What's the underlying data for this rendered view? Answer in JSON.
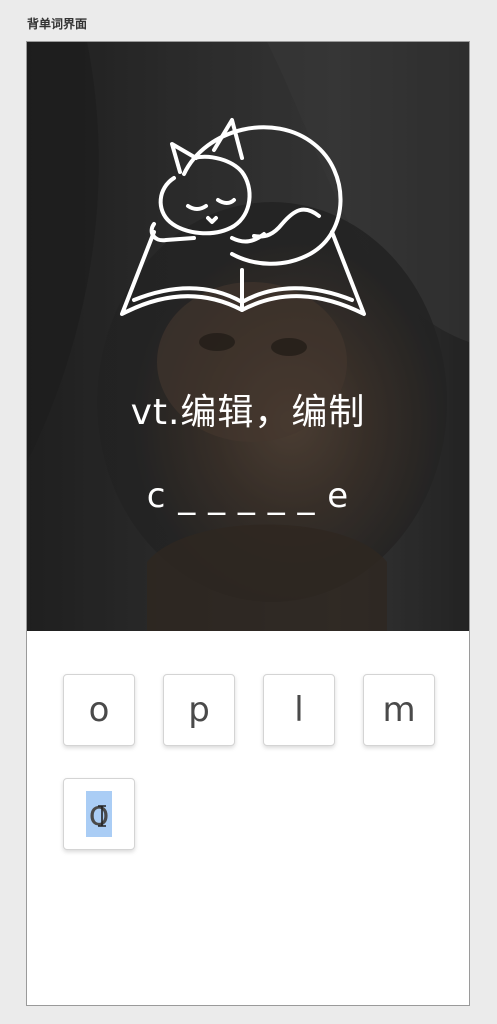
{
  "page_label": "背单词界面",
  "word": {
    "definition": "vt.编辑，编制",
    "pattern": "c _ _ _ _ _ e"
  },
  "letter_keys": [
    {
      "letter": "o"
    },
    {
      "letter": "p"
    },
    {
      "letter": "l"
    },
    {
      "letter": "m"
    },
    {
      "letter": "o"
    }
  ],
  "colors": {
    "hero_overlay": "#3a3a3a",
    "text_on_hero": "#ffffff",
    "selection": "#aacdf5"
  },
  "icons": {
    "logo": "cat-sleeping-on-book-icon",
    "cursor": "text-cursor-icon"
  }
}
